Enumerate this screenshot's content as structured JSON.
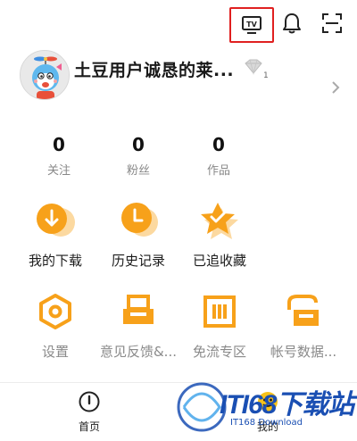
{
  "header": {
    "tv_label": "TV"
  },
  "profile": {
    "username": "土豆用户诚恳的莱...",
    "vip_count": "1"
  },
  "stats": [
    {
      "value": "0",
      "label": "关注"
    },
    {
      "value": "0",
      "label": "粉丝"
    },
    {
      "value": "0",
      "label": "作品"
    }
  ],
  "quick_actions": [
    {
      "label": "我的下载",
      "icon": "download-icon"
    },
    {
      "label": "历史记录",
      "icon": "history-clock-icon"
    },
    {
      "label": "已追收藏",
      "icon": "star-favorite-icon"
    }
  ],
  "tools": [
    {
      "label": "设置",
      "icon": "settings-hex-icon"
    },
    {
      "label": "意见反馈&...",
      "icon": "feedback-printer-icon"
    },
    {
      "label": "免流专区",
      "icon": "free-data-icon"
    },
    {
      "label": "帐号数据...",
      "icon": "account-data-icon"
    }
  ],
  "nav": {
    "home_label": "首页",
    "mine_label": "我的"
  },
  "watermark": {
    "text": "ITI68下载站",
    "sub": "IT168 Download"
  },
  "colors": {
    "accent_orange": "#f7a11a",
    "highlight_red": "#e02020",
    "watermark_blue": "#1a4fb3"
  }
}
